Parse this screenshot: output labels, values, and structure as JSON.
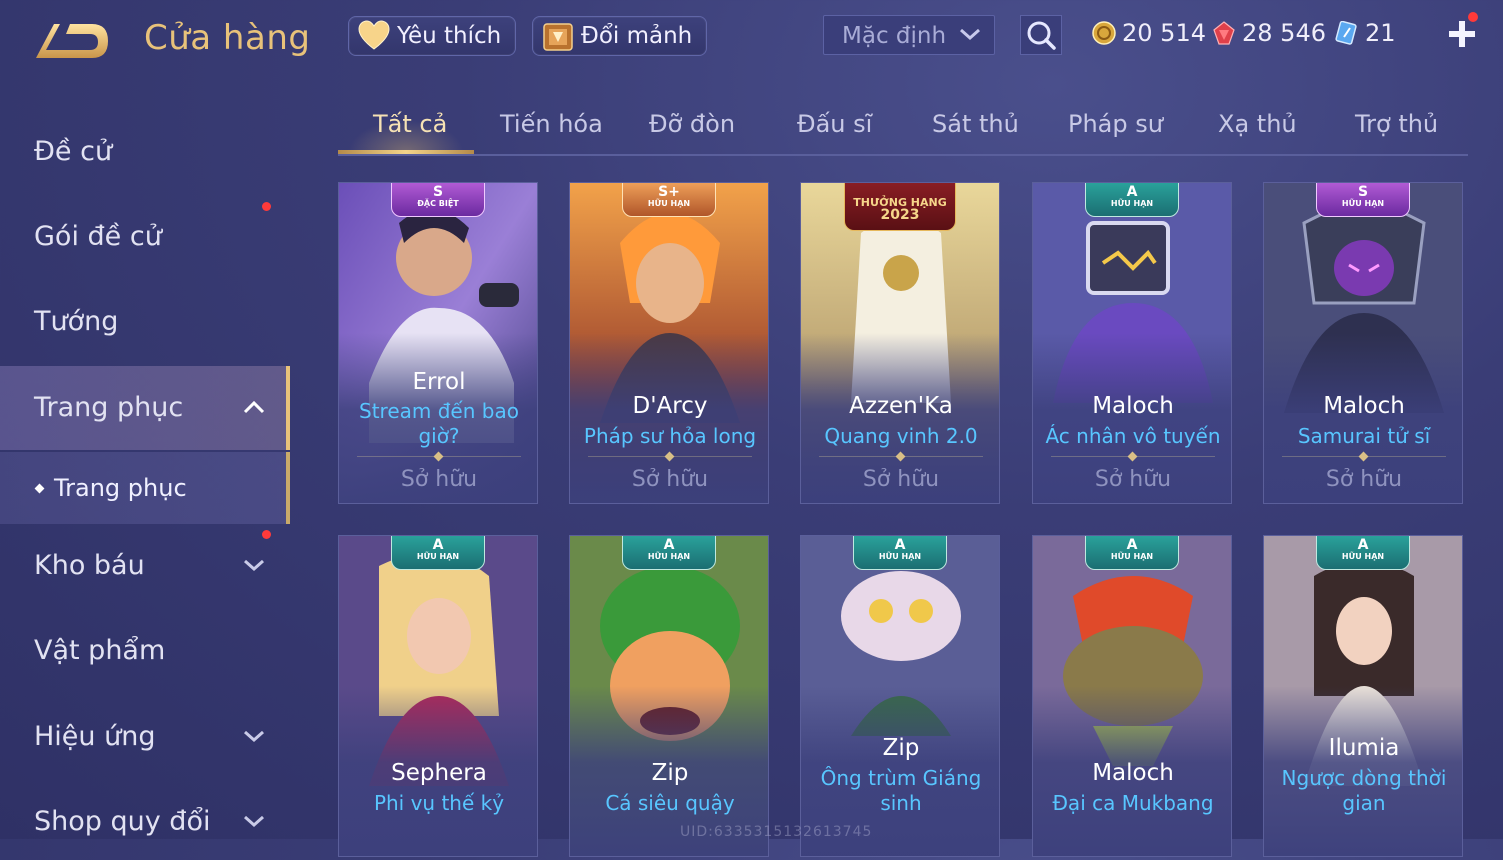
{
  "header": {
    "title": "Cửa hàng",
    "favorite_label": "Yêu thích",
    "fragment_label": "Đổi mảnh",
    "sort_selected": "Mặc định",
    "currencies": {
      "gold": "20 514",
      "ruby": "28 546",
      "voucher": "21"
    }
  },
  "sidebar": {
    "items": [
      {
        "label": "Đề cử"
      },
      {
        "label": "Gói đề cử"
      },
      {
        "label": "Tướng"
      },
      {
        "label": "Trang phục"
      },
      {
        "label": "Kho báu"
      },
      {
        "label": "Vật phẩm"
      },
      {
        "label": "Hiệu ứng"
      },
      {
        "label": "Shop quy đổi"
      }
    ],
    "sub_item": "Trang phục"
  },
  "tabs": [
    "Tất cả",
    "Tiến hóa",
    "Đỡ đòn",
    "Đấu sĩ",
    "Sát thủ",
    "Pháp sư",
    "Xạ thủ",
    "Trợ thủ"
  ],
  "cards": [
    {
      "hero": "Errol",
      "skin": "Stream đến bao giờ?",
      "status": "Sở hữu",
      "badge_tier": "S",
      "badge_sub": "ĐẶC BIỆT"
    },
    {
      "hero": "D'Arcy",
      "skin": "Pháp sư hỏa long",
      "status": "Sở hữu",
      "badge_tier": "S+",
      "badge_sub": "HỮU HẠN"
    },
    {
      "hero": "Azzen'Ka",
      "skin": "Quang vinh 2.0",
      "status": "Sở hữu",
      "badge_tier": "THƯỞNG HẠNG",
      "badge_sub": "2023"
    },
    {
      "hero": "Maloch",
      "skin": "Ác nhân vô tuyến",
      "status": "Sở hữu",
      "badge_tier": "A",
      "badge_sub": "HỮU HẠN"
    },
    {
      "hero": "Maloch",
      "skin": "Samurai tử sĩ",
      "status": "Sở hữu",
      "badge_tier": "S",
      "badge_sub": "HỮU HẠN"
    },
    {
      "hero": "Sephera",
      "skin": "Phi vụ thế kỷ",
      "badge_tier": "A",
      "badge_sub": "HỮU HẠN"
    },
    {
      "hero": "Zip",
      "skin": "Cá siêu quậy",
      "badge_tier": "A",
      "badge_sub": "HỮU HẠN"
    },
    {
      "hero": "Zip",
      "skin": "Ông trùm Giáng sinh",
      "badge_tier": "A",
      "badge_sub": "HỮU HẠN"
    },
    {
      "hero": "Maloch",
      "skin": "Đại ca Mukbang",
      "badge_tier": "A",
      "badge_sub": "HỮU HẠN"
    },
    {
      "hero": "Ilumia",
      "skin": "Ngược dòng thời gian",
      "badge_tier": "A",
      "badge_sub": "HỮU HẠN"
    }
  ],
  "uid_text": "UID:6335315132613745",
  "colors": {
    "accent_gold": "#e8c27a",
    "skin_name_blue": "#58c6ff",
    "notification_red": "#ff3a3a",
    "background": "#3a3d76"
  },
  "icons": [
    "back-arrow-icon",
    "heart-icon",
    "fragment-chest-icon",
    "chevron-down-icon",
    "search-icon",
    "gold-coin-icon",
    "ruby-gem-icon",
    "voucher-icon",
    "plus-icon",
    "chevron-up-icon"
  ]
}
